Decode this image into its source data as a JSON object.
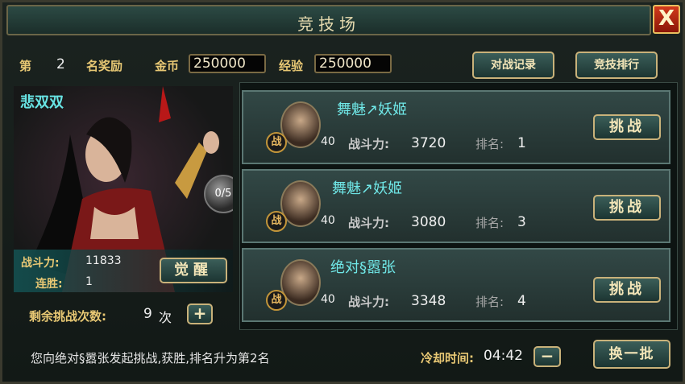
{
  "window": {
    "title": "竞技场",
    "close_icon": "close-icon",
    "close_label": "X"
  },
  "reward": {
    "prefix": "第",
    "rank": "2",
    "suffix": "名奖励",
    "gold_label": "金币",
    "gold_value": "250000",
    "exp_label": "经验",
    "exp_value": "250000"
  },
  "buttons": {
    "battle_log": "对战记录",
    "arena_rank": "竞技排行",
    "awaken": "觉醒",
    "refresh": "换一批",
    "add_icon": "plus-icon",
    "minus_icon": "minus-icon"
  },
  "hero": {
    "name": "悲双双",
    "orb_text": "0/5",
    "power_label": "战斗力:",
    "power_value": "11833",
    "streak_label": "连胜:",
    "streak_value": "1"
  },
  "challenges": {
    "label": "剩余挑战次数:",
    "count": "9",
    "unit": "次"
  },
  "opponents": [
    {
      "name": "舞魅↗妖姬",
      "level": "40",
      "badge": "战",
      "power_label": "战斗力:",
      "power": "3720",
      "rank_label": "排名:",
      "rank": "1",
      "button": "挑战"
    },
    {
      "name": "舞魅↗妖姬",
      "level": "40",
      "badge": "战",
      "power_label": "战斗力:",
      "power": "3080",
      "rank_label": "排名:",
      "rank": "3",
      "button": "挑战"
    },
    {
      "name": "绝对§嚣张",
      "level": "40",
      "badge": "战",
      "power_label": "战斗力:",
      "power": "3348",
      "rank_label": "排名:",
      "rank": "4",
      "button": "挑战"
    }
  ],
  "footer": {
    "message": "您向绝对§嚣张发起挑战,获胜,排名升为第2名",
    "cooldown_label": "冷却时间:",
    "cooldown_value": "04:42"
  }
}
